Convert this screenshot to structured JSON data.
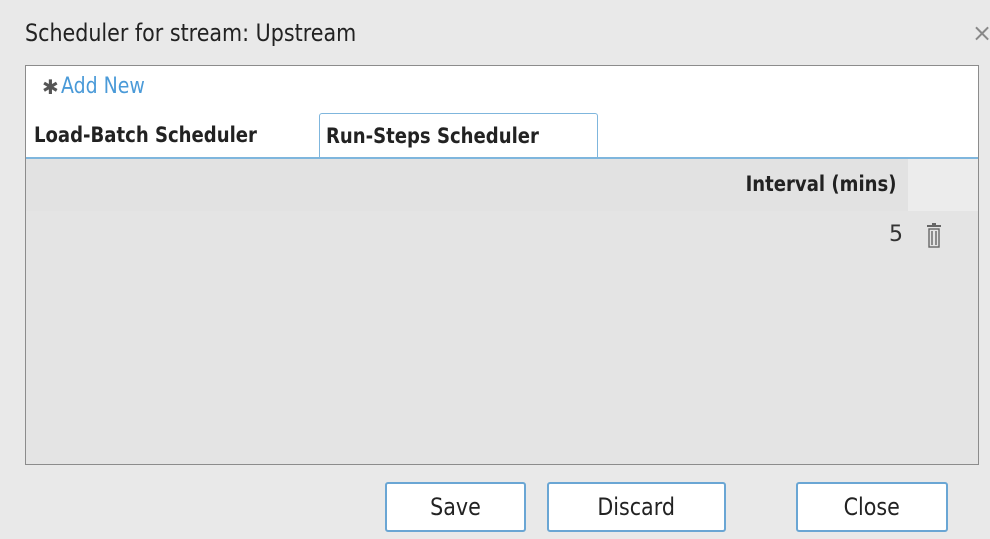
{
  "dialog": {
    "title": "Scheduler for stream: Upstream",
    "close_glyph": "×"
  },
  "toolbar": {
    "add_new_icon": "asterisk-icon",
    "add_new_glyph": "✱",
    "add_new_label": "Add New"
  },
  "tabs": [
    {
      "label": "Load-Batch Scheduler",
      "active": false
    },
    {
      "label": "Run-Steps Scheduler",
      "active": true
    }
  ],
  "grid": {
    "columns": [
      "Interval (mins)"
    ],
    "rows": [
      {
        "interval": "5",
        "action_icon": "trash-icon"
      }
    ]
  },
  "footer": {
    "save_label": "Save",
    "discard_label": "Discard",
    "close_label": "Close"
  },
  "colors": {
    "accent": "#6aa6d4",
    "link": "#4a9ad8",
    "background": "#e9e9e9"
  }
}
